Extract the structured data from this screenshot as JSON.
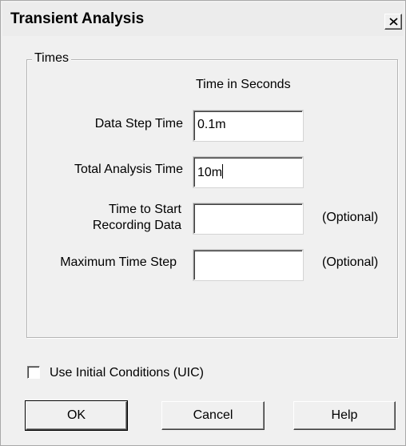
{
  "window": {
    "title": "Transient Analysis",
    "close_glyph": "×"
  },
  "group": {
    "legend": "Times",
    "column_header": "Time in Seconds"
  },
  "fields": {
    "data_step": {
      "label": "Data Step Time",
      "value": "0.1m"
    },
    "total_analysis": {
      "label": "Total Analysis Time",
      "value": "10m"
    },
    "start_recording": {
      "label_line1": "Time to Start",
      "label_line2": "Recording Data",
      "value": "",
      "hint": "(Optional)"
    },
    "max_step": {
      "label": "Maximum Time Step",
      "value": "",
      "hint": "(Optional)"
    }
  },
  "uic": {
    "label": "Use Initial Conditions (UIC)",
    "checked": false
  },
  "buttons": {
    "ok": "OK",
    "cancel": "Cancel",
    "help": "Help"
  },
  "icons": {
    "close": "close-icon"
  }
}
